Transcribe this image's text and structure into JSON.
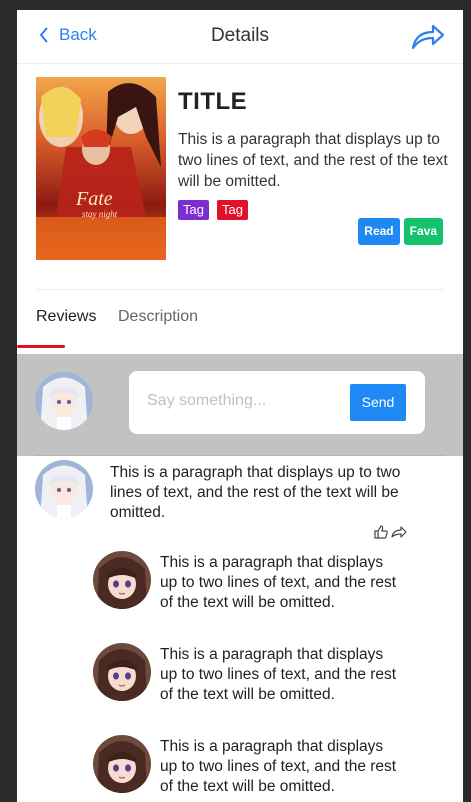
{
  "header": {
    "back_label": "Back",
    "title": "Details"
  },
  "detail": {
    "title": "TITLE",
    "description": "This is a paragraph that displays up to two lines of text, and the rest of the text will be omitted.",
    "tags": [
      "Tag",
      "Tag"
    ],
    "read_label": "Read",
    "fava_label": "Fava",
    "cover_text": {
      "line1": "Fate",
      "line2": "stay night"
    }
  },
  "tabs": [
    {
      "label": "Reviews"
    },
    {
      "label": "Description"
    }
  ],
  "compose": {
    "placeholder": "Say something...",
    "send_label": "Send"
  },
  "comments": [
    {
      "text": "This is a paragraph that displays up to two lines of text, and the rest of the text will be omitted."
    },
    {
      "text": "This is a paragraph that displays up to two lines of text, and the rest of the text will be omitted."
    },
    {
      "text": "This is a paragraph that displays up to two lines of text, and the rest of the text will be omitted."
    },
    {
      "text": "This is a paragraph that displays up to two lines of text, and the rest of the text will be omitted."
    }
  ]
}
